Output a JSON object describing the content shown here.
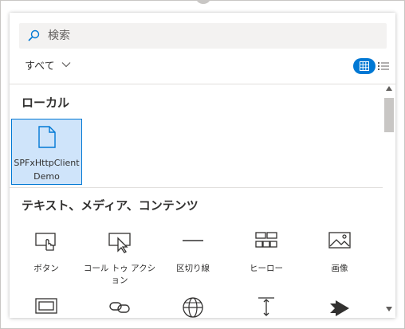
{
  "search": {
    "placeholder": "検索"
  },
  "filter": {
    "label": "すべて"
  },
  "sections": {
    "local": {
      "heading": "ローカル",
      "item_label": "SPFxHttpClient Demo"
    },
    "text_media": {
      "heading": "テキスト、メディア、コンテンツ"
    }
  },
  "tiles": [
    {
      "label": "ボタン",
      "icon": "button-icon"
    },
    {
      "label": "コール トゥ アクション",
      "icon": "call-to-action-icon"
    },
    {
      "label": "区切り線",
      "icon": "divider-icon"
    },
    {
      "label": "ヒーロー",
      "icon": "hero-icon"
    },
    {
      "label": "画像",
      "icon": "image-icon"
    }
  ],
  "next_row_icons": [
    "embed-icon",
    "link-icon",
    "globe-icon",
    "spacer-icon",
    "stream-icon"
  ],
  "colors": {
    "accent": "#0078d4",
    "selected_bg": "#cfe4fa"
  }
}
